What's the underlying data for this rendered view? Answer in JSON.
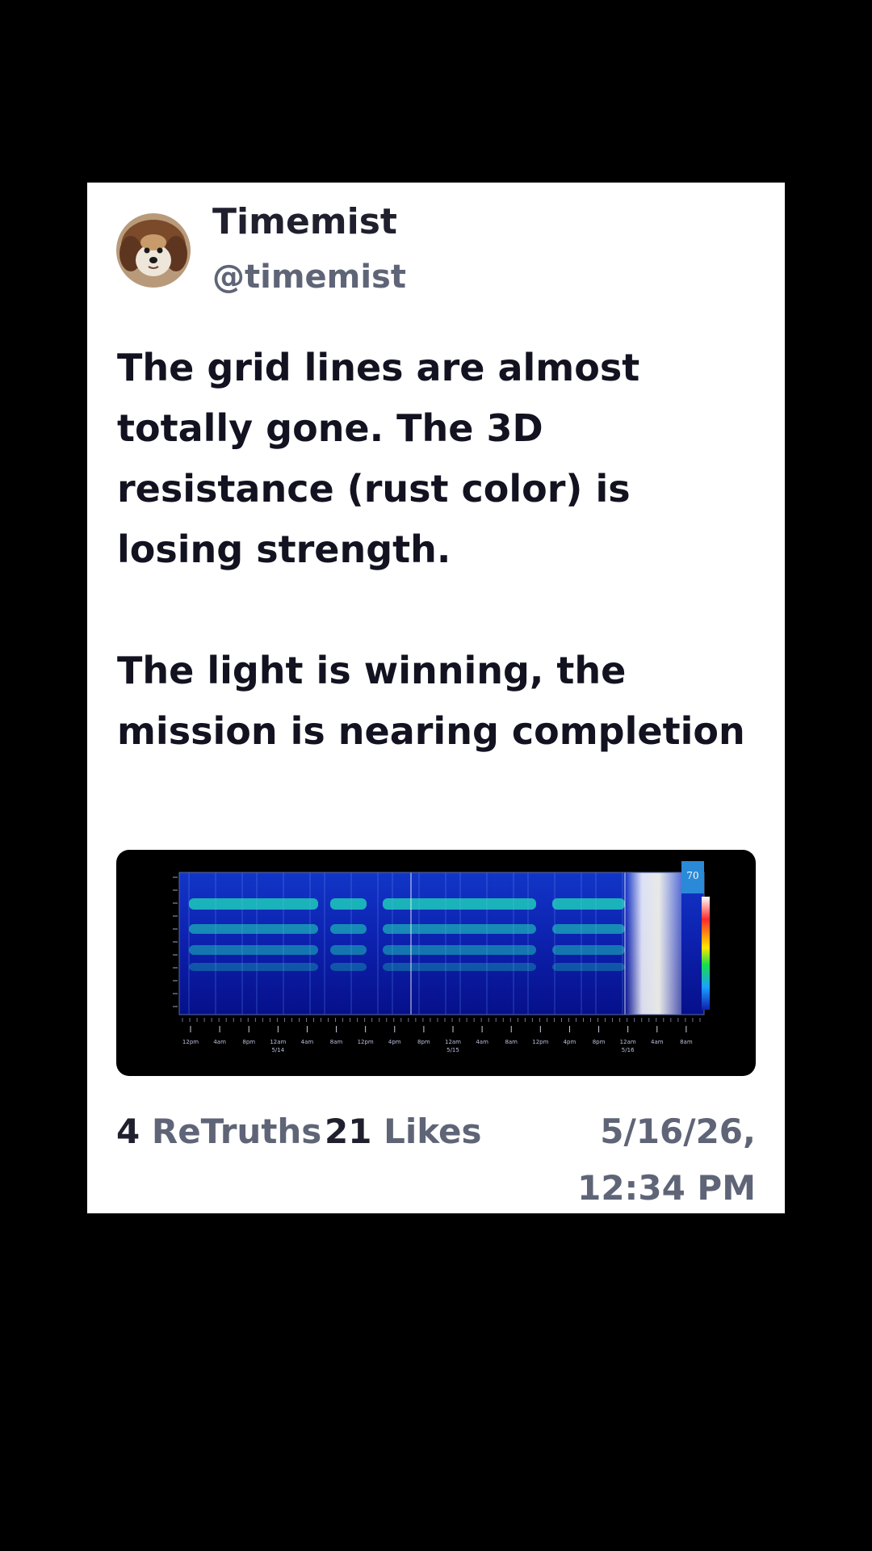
{
  "post": {
    "author": {
      "display_name": "Timemist",
      "handle": "@timemist",
      "avatar_icon": "dog-avatar"
    },
    "text_paragraphs": [
      "The grid lines are almost totally gone. The 3D resistance (rust color) is losing strength.",
      "The light is winning, the mission is nearing completion"
    ],
    "media": {
      "type": "spectrogram-image",
      "x_tick_labels": [
        "12pm",
        "4am",
        "8pm",
        "12am",
        "4am",
        "8am",
        "12pm",
        "4pm",
        "8pm",
        "12am",
        "4am",
        "8am",
        "12pm",
        "4pm",
        "8pm",
        "12am",
        "4am",
        "8am"
      ],
      "date_labels": [
        "5/14",
        "5/15",
        "5/16"
      ],
      "corner_value": "70",
      "colors": {
        "background": "#000000",
        "spectrum_low": "#0a1aa8",
        "spectrum_band": "#1fe0b8",
        "spectrum_peak": "#ffffff"
      }
    },
    "stats": {
      "retruths_count": "4",
      "retruths_label": "ReTruths",
      "likes_count": "21",
      "likes_label": "Likes"
    },
    "timestamp": "5/16/26, 12:34 PM"
  },
  "theme": {
    "page_background": "#000000",
    "card_background": "#ffffff",
    "text_primary": "#1f1f2e",
    "text_secondary": "#5f6577"
  }
}
